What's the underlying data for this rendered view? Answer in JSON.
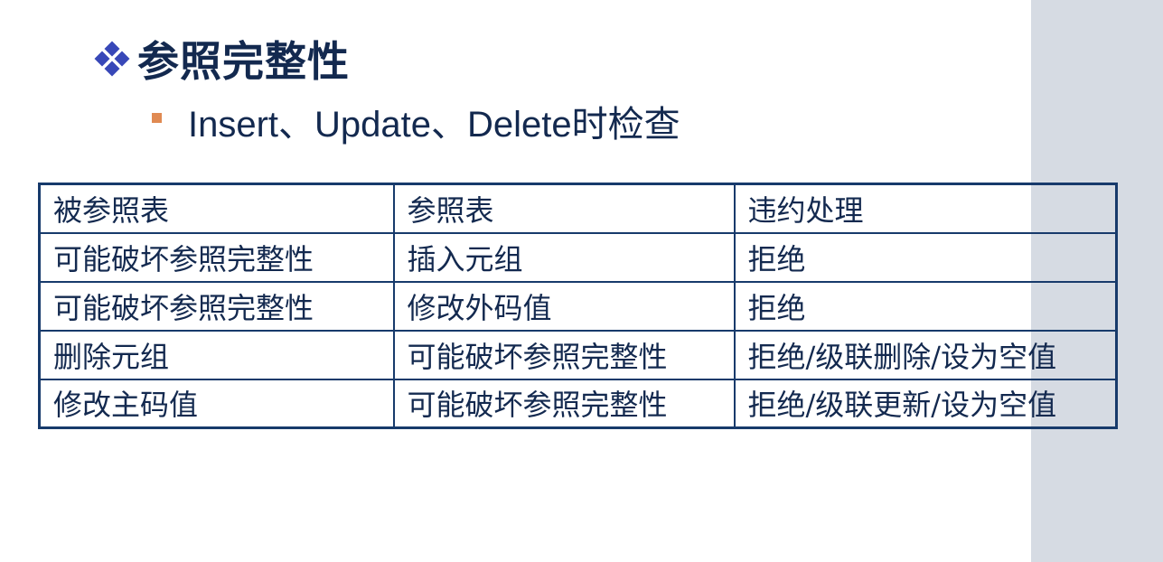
{
  "slide": {
    "heading": "参照完整性",
    "bullet": "Insert、Update、Delete时检查"
  },
  "table": {
    "headers": [
      "被参照表",
      "参照表",
      "违约处理"
    ],
    "rows": [
      [
        "可能破坏参照完整性",
        "插入元组",
        "拒绝"
      ],
      [
        "可能破坏参照完整性",
        "修改外码值",
        "拒绝"
      ],
      [
        "删除元组",
        "可能破坏参照完整性",
        "拒绝/级联删除/设为空值"
      ],
      [
        "修改主码值",
        "可能破坏参照完整性",
        "拒绝/级联更新/设为空值"
      ]
    ]
  },
  "colors": {
    "heading_text": "#13294f",
    "heading_icon": "#3848b8",
    "bullet_mark": "#e08a52",
    "table_border": "#173a6b",
    "side_band": "#d6dbe3"
  },
  "icons": {
    "heading": "four-diamond-bullet-icon",
    "bullet": "square-bullet-icon"
  }
}
